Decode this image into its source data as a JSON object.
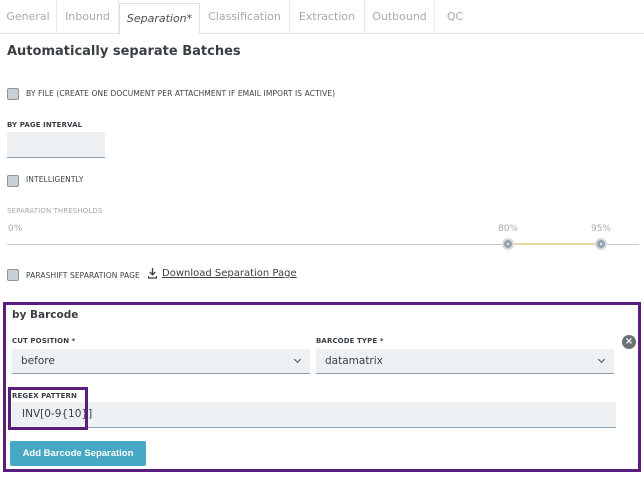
{
  "tabs": [
    {
      "label": "General"
    },
    {
      "label": "Inbound"
    },
    {
      "label": "Separation*"
    },
    {
      "label": "Classification"
    },
    {
      "label": "Extraction"
    },
    {
      "label": "Outbound"
    },
    {
      "label": "QC"
    }
  ],
  "active_tab": "Separation*",
  "section_title": "Automatically separate Batches",
  "by_file": {
    "label": "BY FILE (CREATE ONE DOCUMENT PER ATTACHMENT IF EMAIL IMPORT IS ACTIVE)",
    "checked": false
  },
  "page_interval": {
    "label": "BY PAGE INTERVAL",
    "value": ""
  },
  "intelligently": {
    "label": "INTELLIGENTLY",
    "checked": false
  },
  "thresholds": {
    "label": "SEPARATION THRESHOLDS",
    "min_label": "0%",
    "low_label": "80%",
    "high_label": "95%",
    "low_value": 80,
    "high_value": 95
  },
  "parashift_page": {
    "label": "PARASHIFT SEPARATION PAGE",
    "checked": false
  },
  "download_link": "Download Separation Page",
  "barcode": {
    "title": "by Barcode",
    "cut_position": {
      "label": "CUT POSITION *",
      "value": "before"
    },
    "barcode_type": {
      "label": "BARCODE TYPE *",
      "value": "datamatrix"
    },
    "remove_symbol": "×",
    "regex": {
      "label": "REGEX PATTERN",
      "value": "INV[0-9{10}]"
    },
    "add_button": "Add Barcode Separation"
  },
  "colors": {
    "highlight": "#5a1e7c",
    "button": "#46a9c4",
    "field_bg": "#eef1f4"
  }
}
